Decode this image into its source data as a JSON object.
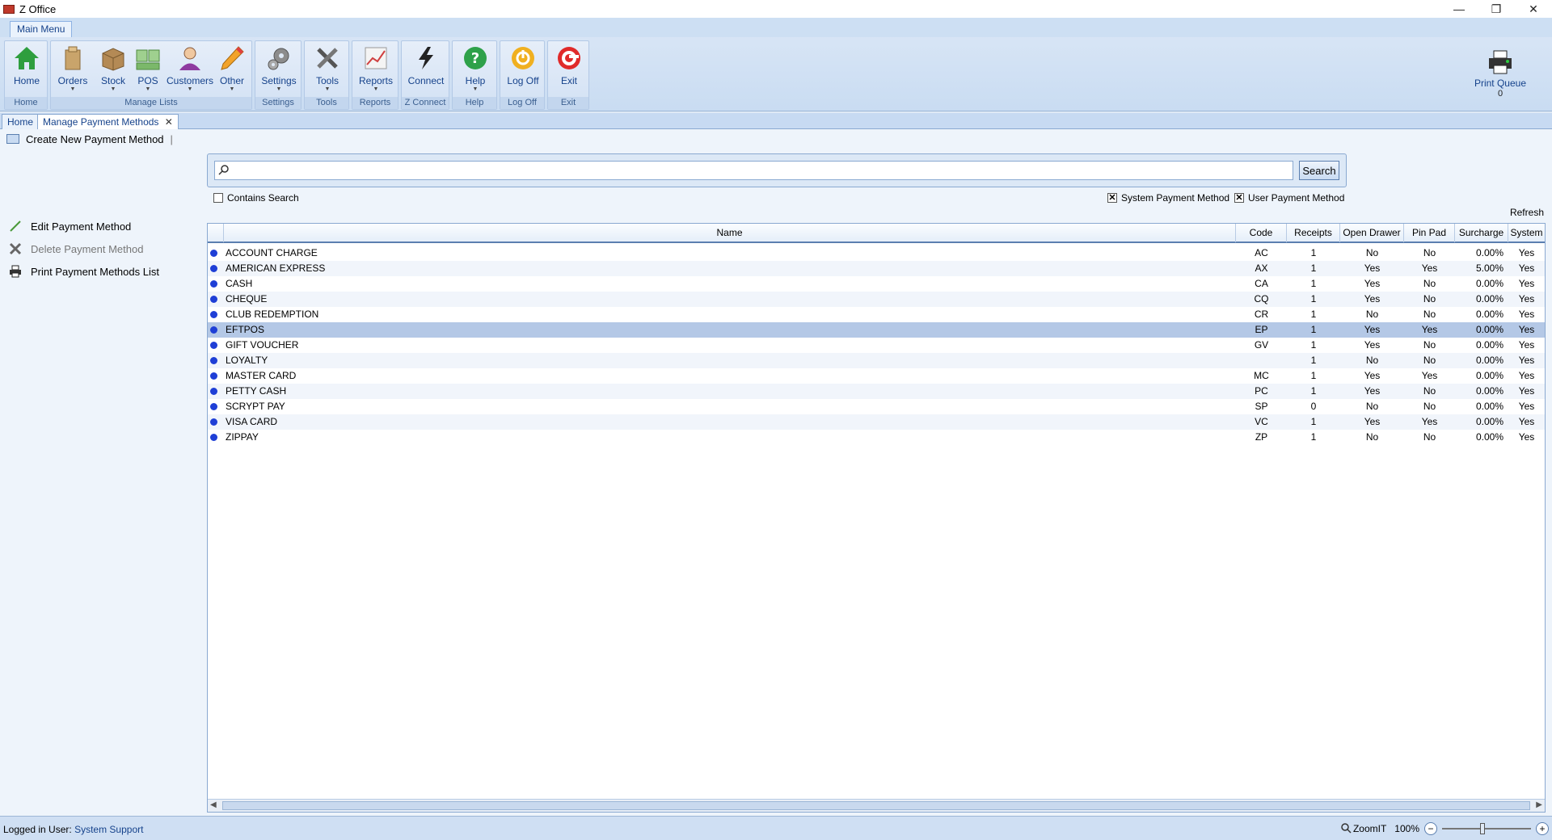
{
  "window": {
    "title": "Z Office",
    "minimize": "—",
    "restore": "❐",
    "close": "✕"
  },
  "ribbon": {
    "tab": "Main Menu",
    "buttons": {
      "home": "Home",
      "orders": "Orders",
      "stock": "Stock",
      "pos": "POS",
      "customers": "Customers",
      "other": "Other",
      "settings": "Settings",
      "tools": "Tools",
      "reports": "Reports",
      "connect": "Connect",
      "help": "Help",
      "logoff": "Log Off",
      "exit": "Exit",
      "print_queue": "Print Queue",
      "print_queue_count": "0"
    },
    "groups": {
      "home": "Home",
      "manage_lists": "Manage Lists",
      "settings": "Settings",
      "tools": "Tools",
      "reports": "Reports",
      "zconnect": "Z Connect",
      "help": "Help",
      "logoff": "Log Off",
      "exit": "Exit"
    }
  },
  "doc_tabs": {
    "home": "Home",
    "manage": "Manage Payment Methods",
    "close": "✕"
  },
  "toolbar": {
    "create_new": "Create New Payment Method"
  },
  "side": {
    "edit": "Edit Payment Method",
    "delete": "Delete Payment Method",
    "print": "Print Payment Methods List"
  },
  "search": {
    "placeholder": "",
    "button": "Search",
    "contains": "Contains Search",
    "system": "System Payment Method",
    "user": "User Payment Method",
    "refresh": "Refresh"
  },
  "grid": {
    "columns": [
      "Name",
      "Code",
      "Receipts",
      "Open Drawer",
      "Pin Pad",
      "Surcharge",
      "System"
    ],
    "rows": [
      [
        "ACCOUNT CHARGE",
        "AC",
        "1",
        "No",
        "No",
        "0.00%",
        "Yes"
      ],
      [
        "AMERICAN EXPRESS",
        "AX",
        "1",
        "Yes",
        "Yes",
        "5.00%",
        "Yes"
      ],
      [
        "CASH",
        "CA",
        "1",
        "Yes",
        "No",
        "0.00%",
        "Yes"
      ],
      [
        "CHEQUE",
        "CQ",
        "1",
        "Yes",
        "No",
        "0.00%",
        "Yes"
      ],
      [
        "CLUB REDEMPTION",
        "CR",
        "1",
        "No",
        "No",
        "0.00%",
        "Yes"
      ],
      [
        "EFTPOS",
        "EP",
        "1",
        "Yes",
        "Yes",
        "0.00%",
        "Yes"
      ],
      [
        "GIFT VOUCHER",
        "GV",
        "1",
        "Yes",
        "No",
        "0.00%",
        "Yes"
      ],
      [
        "LOYALTY",
        "",
        "1",
        "No",
        "No",
        "0.00%",
        "Yes"
      ],
      [
        "MASTER CARD",
        "MC",
        "1",
        "Yes",
        "Yes",
        "0.00%",
        "Yes"
      ],
      [
        "PETTY CASH",
        "PC",
        "1",
        "Yes",
        "No",
        "0.00%",
        "Yes"
      ],
      [
        "SCRYPT PAY",
        "SP",
        "0",
        "No",
        "No",
        "0.00%",
        "Yes"
      ],
      [
        "VISA CARD",
        "VC",
        "1",
        "Yes",
        "Yes",
        "0.00%",
        "Yes"
      ],
      [
        "ZIPPAY",
        "ZP",
        "1",
        "No",
        "No",
        "0.00%",
        "Yes"
      ]
    ],
    "selected_index": 5
  },
  "status": {
    "logged_label": "Logged in User:",
    "user": "System Support",
    "zoomit": "ZoomIT",
    "zoom": "100%"
  },
  "colors": {
    "accent": "#15428b",
    "ribbon": "#c9dcf2",
    "selected_row": "#b4c8e6"
  }
}
